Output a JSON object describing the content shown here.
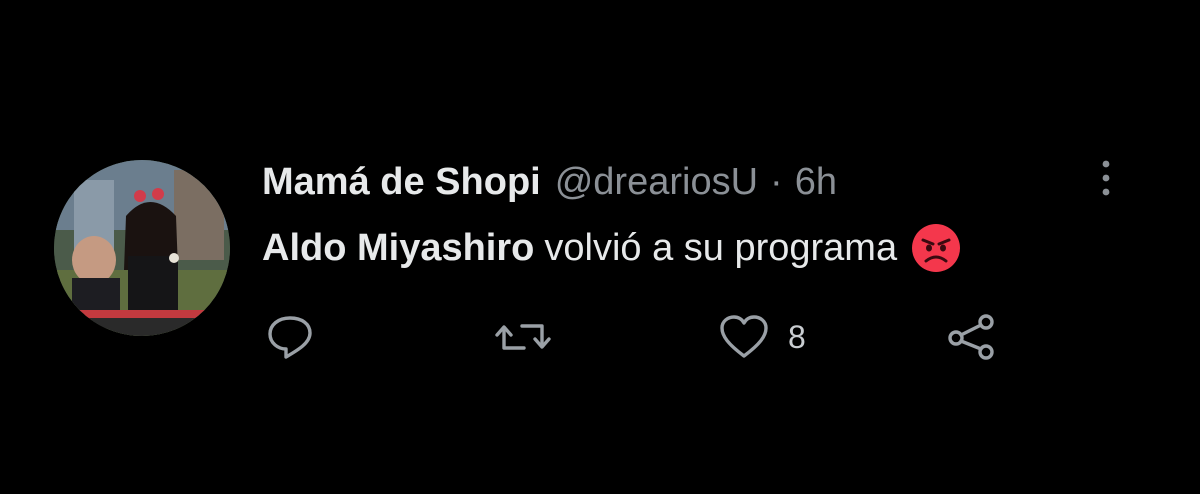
{
  "tweet": {
    "author": {
      "display_name": "Mamá de Shopi",
      "handle": "@dreariosU",
      "separator": "·",
      "time": "6h"
    },
    "text": {
      "mention": "Aldo Miyashiro",
      "rest": "volvió a su programa"
    },
    "icons": {
      "more": "more-vertical-icon",
      "emoji": "angry-face-emoji-icon",
      "reply": "reply-icon",
      "retweet": "retweet-icon",
      "like": "heart-icon",
      "share": "share-icon"
    },
    "actions": {
      "like_count": "8"
    },
    "colors": {
      "background": "#000000",
      "text": "#e7e9ea",
      "secondary": "#8b9096",
      "emoji": "#f4374c"
    }
  }
}
